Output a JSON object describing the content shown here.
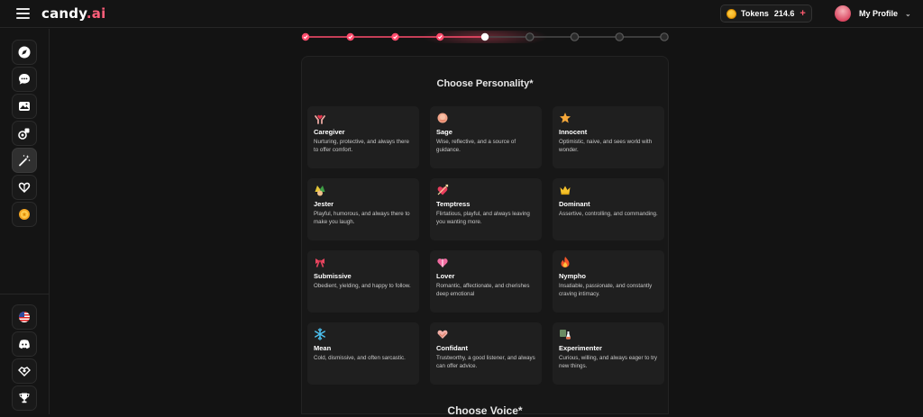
{
  "header": {
    "logo_main": "candy",
    "logo_accent": ".ai",
    "tokens_label": "Tokens",
    "tokens_value": "214.6",
    "tokens_add": "+",
    "profile_label": "My Profile",
    "profile_chevron": "⌄"
  },
  "sidebar": {
    "items": [
      {
        "icon": "compass-icon"
      },
      {
        "icon": "chat-icon"
      },
      {
        "icon": "gallery-icon"
      },
      {
        "icon": "generate-image-icon"
      },
      {
        "icon": "magic-wand-icon",
        "active": true
      },
      {
        "icon": "my-ai-icon"
      },
      {
        "icon": "premium-coin-icon"
      }
    ],
    "bottom_items": [
      {
        "icon": "us-flag-icon"
      },
      {
        "icon": "discord-icon"
      },
      {
        "icon": "affiliate-icon"
      },
      {
        "icon": "trophy-icon"
      }
    ]
  },
  "progress": {
    "total_steps": 9,
    "current_step": 5
  },
  "personality": {
    "title": "Choose Personality*",
    "options": [
      {
        "name": "Caregiver",
        "desc": "Nurturing, protective, and always there to offer comfort.",
        "icon": "caregiver-icon"
      },
      {
        "name": "Sage",
        "desc": "Wise, reflective, and a source of guidance.",
        "icon": "sage-icon"
      },
      {
        "name": "Innocent",
        "desc": "Optimistic, naive, and sees world with wonder.",
        "icon": "star-icon"
      },
      {
        "name": "Jester",
        "desc": "Playful, humorous, and always there to make you laugh.",
        "icon": "jester-icon"
      },
      {
        "name": "Temptress",
        "desc": "Flirtatious, playful, and always leaving you wanting more.",
        "icon": "temptress-icon"
      },
      {
        "name": "Dominant",
        "desc": "Assertive, controlling, and commanding.",
        "icon": "crown-icon"
      },
      {
        "name": "Submissive",
        "desc": "Obedient, yielding, and happy to follow.",
        "icon": "ribbon-icon"
      },
      {
        "name": "Lover",
        "desc": "Romantic, affectionate, and cherishes deep emotional",
        "icon": "heart-gift-icon"
      },
      {
        "name": "Nympho",
        "desc": "Insatiable, passionate, and constantly craving intimacy.",
        "icon": "fire-icon"
      },
      {
        "name": "Mean",
        "desc": "Cold, dismissive, and often sarcastic.",
        "icon": "snowflake-icon"
      },
      {
        "name": "Confidant",
        "desc": "Trustworthy, a good listener, and always can offer advice.",
        "icon": "handshake-heart-icon"
      },
      {
        "name": "Experimenter",
        "desc": "Curious, willing, and always eager to try new things.",
        "icon": "experiment-icon"
      }
    ]
  },
  "voice": {
    "title": "Choose Voice*"
  },
  "colors": {
    "accent": "#ff5e7a",
    "progress_done": "#ff4d6d",
    "background": "#131313",
    "card": "#1f1f1f"
  }
}
